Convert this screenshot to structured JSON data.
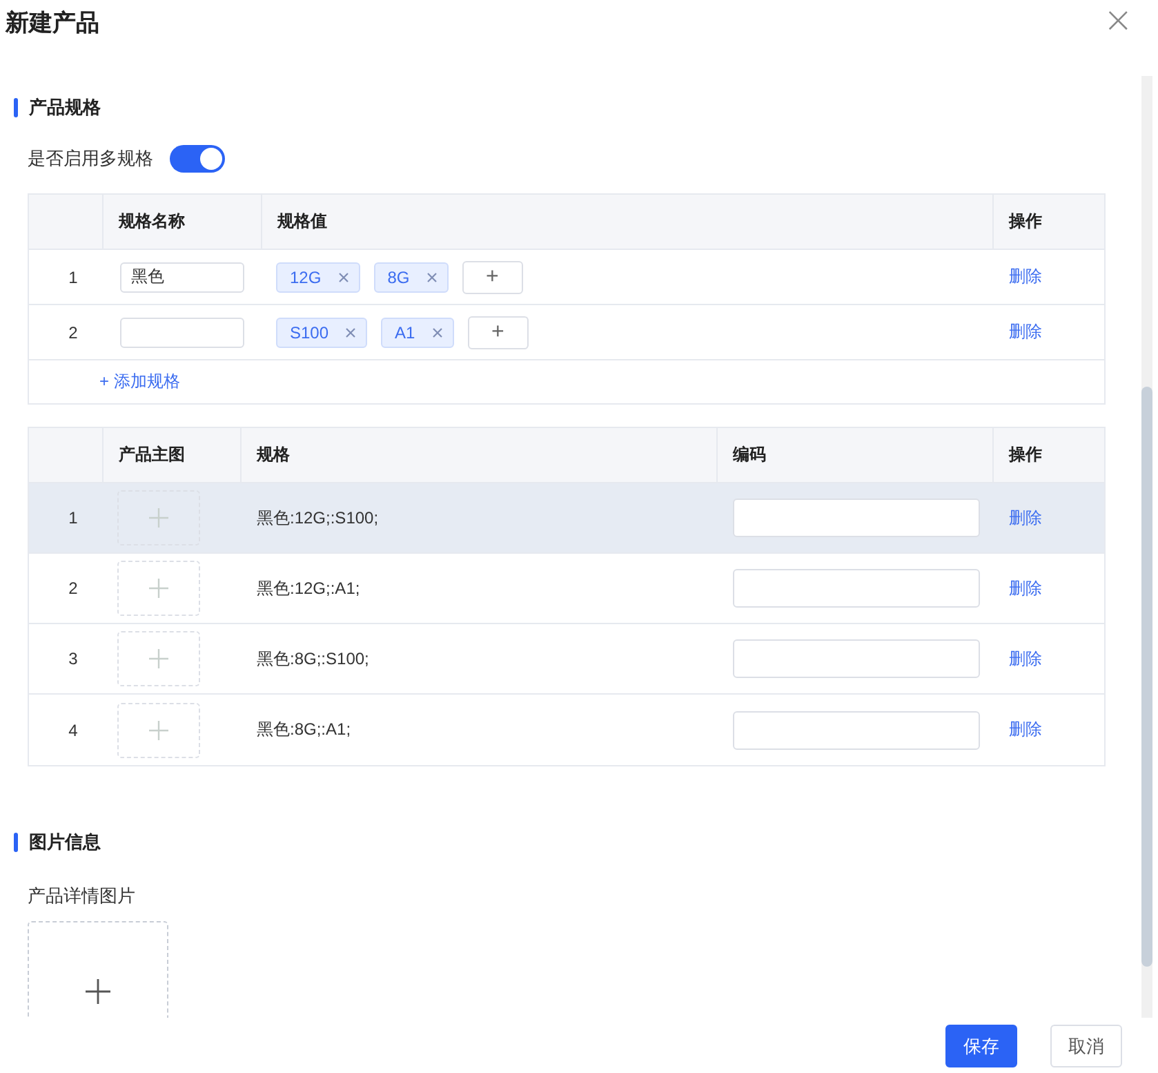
{
  "dialog": {
    "title": "新建产品",
    "close": "×"
  },
  "spec_section": {
    "title": "产品规格",
    "toggle": {
      "label": "是否启用多规格",
      "on": true
    },
    "spec_table": {
      "columns": [
        "规格名称",
        "规格值",
        "操作"
      ],
      "rows": [
        {
          "index": "1",
          "name": "黑色",
          "values": [
            "12G",
            "8G"
          ],
          "add": "+",
          "action": "删除"
        },
        {
          "index": "2",
          "name": "",
          "values": [
            "S100",
            "A1"
          ],
          "add": "+",
          "action": "删除"
        }
      ],
      "add_link": "+ 添加规格"
    },
    "sku_table": {
      "columns": [
        "产品主图",
        "规格",
        "编码",
        "操作"
      ],
      "rows": [
        {
          "index": "1",
          "spec": "黑色:12G;:S100;",
          "action": "删除",
          "highlighted": true
        },
        {
          "index": "2",
          "spec": "黑色:12G;:A1;",
          "action": "删除",
          "highlighted": false
        },
        {
          "index": "3",
          "spec": "黑色:8G;:S100;",
          "action": "删除",
          "highlighted": false
        },
        {
          "index": "4",
          "spec": "黑色:8G;:A1;",
          "action": "删除",
          "highlighted": false
        }
      ]
    }
  },
  "image_section": {
    "title": "图片信息",
    "label": "产品详情图片"
  },
  "buttons": [
    {
      "kind": "primary",
      "label": "保存"
    },
    {
      "kind": "default",
      "label": "取消"
    }
  ]
}
